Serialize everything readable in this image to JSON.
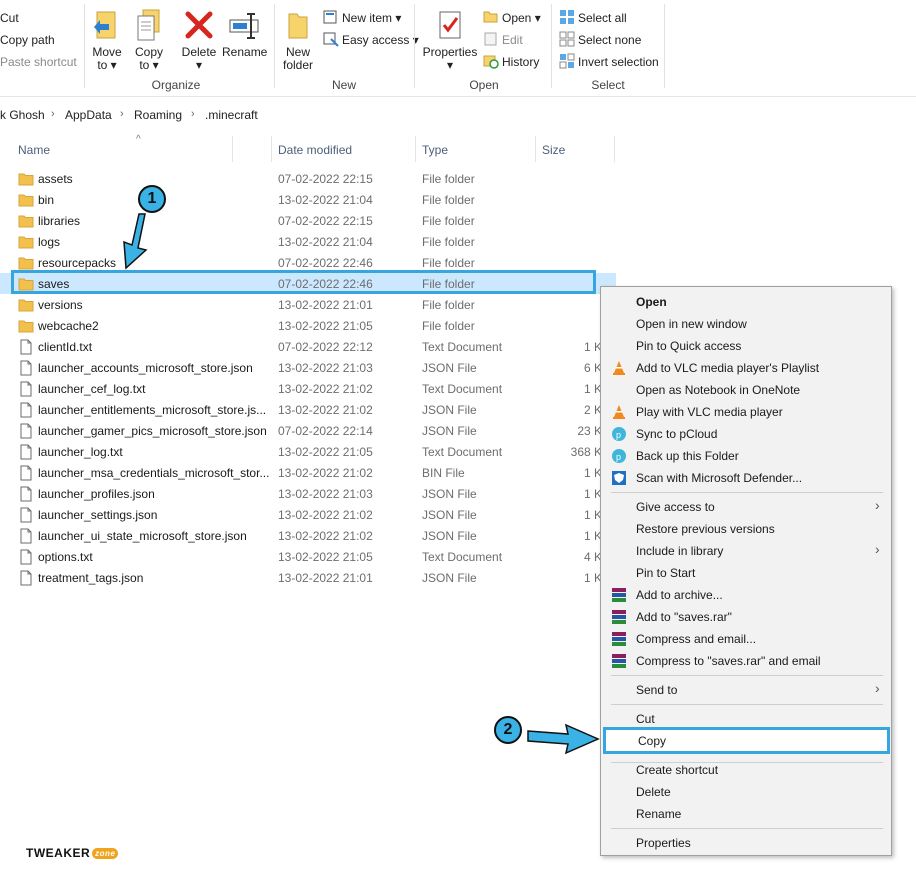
{
  "ribbon": {
    "clipboard": {
      "cut": "Cut",
      "copy_path": "Copy path",
      "paste_shortcut": "Paste shortcut"
    },
    "organize": {
      "move_to": "Move",
      "move_to2": "to ▾",
      "copy_to": "Copy",
      "copy_to2": "to ▾",
      "delete": "Delete",
      "delete2": "▾",
      "rename": "Rename",
      "label": "Organize"
    },
    "new": {
      "new_folder": "New",
      "new_folder2": "folder",
      "new_item": "New item ▾",
      "easy_access": "Easy access ▾",
      "label": "New"
    },
    "open": {
      "properties": "Properties",
      "properties2": "▾",
      "open": "Open ▾",
      "edit": "Edit",
      "history": "History",
      "label": "Open"
    },
    "select": {
      "select_all": "Select all",
      "select_none": "Select none",
      "invert": "Invert selection",
      "label": "Select"
    }
  },
  "breadcrumb": [
    "k Ghosh",
    "AppData",
    "Roaming",
    ".minecraft"
  ],
  "columns": {
    "name": "Name",
    "date": "Date modified",
    "type": "Type",
    "size": "Size"
  },
  "files": [
    {
      "name": "assets",
      "date": "07-02-2022 22:15",
      "type": "File folder",
      "size": "",
      "kind": "folder"
    },
    {
      "name": "bin",
      "date": "13-02-2022 21:04",
      "type": "File folder",
      "size": "",
      "kind": "folder"
    },
    {
      "name": "libraries",
      "date": "07-02-2022 22:15",
      "type": "File folder",
      "size": "",
      "kind": "folder"
    },
    {
      "name": "logs",
      "date": "13-02-2022 21:04",
      "type": "File folder",
      "size": "",
      "kind": "folder"
    },
    {
      "name": "resourcepacks",
      "date": "07-02-2022 22:46",
      "type": "File folder",
      "size": "",
      "kind": "folder"
    },
    {
      "name": "saves",
      "date": "07-02-2022 22:46",
      "type": "File folder",
      "size": "",
      "kind": "folder",
      "selected": true
    },
    {
      "name": "versions",
      "date": "13-02-2022 21:01",
      "type": "File folder",
      "size": "",
      "kind": "folder"
    },
    {
      "name": "webcache2",
      "date": "13-02-2022 21:05",
      "type": "File folder",
      "size": "",
      "kind": "folder"
    },
    {
      "name": "clientId.txt",
      "date": "07-02-2022 22:12",
      "type": "Text Document",
      "size": "1 K",
      "kind": "file"
    },
    {
      "name": "launcher_accounts_microsoft_store.json",
      "date": "13-02-2022 21:03",
      "type": "JSON File",
      "size": "6 K",
      "kind": "file"
    },
    {
      "name": "launcher_cef_log.txt",
      "date": "13-02-2022 21:02",
      "type": "Text Document",
      "size": "1 K",
      "kind": "file"
    },
    {
      "name": "launcher_entitlements_microsoft_store.js...",
      "date": "13-02-2022 21:02",
      "type": "JSON File",
      "size": "2 K",
      "kind": "file"
    },
    {
      "name": "launcher_gamer_pics_microsoft_store.json",
      "date": "07-02-2022 22:14",
      "type": "JSON File",
      "size": "23 K",
      "kind": "file"
    },
    {
      "name": "launcher_log.txt",
      "date": "13-02-2022 21:05",
      "type": "Text Document",
      "size": "368 K",
      "kind": "file"
    },
    {
      "name": "launcher_msa_credentials_microsoft_stor...",
      "date": "13-02-2022 21:02",
      "type": "BIN File",
      "size": "1 K",
      "kind": "file"
    },
    {
      "name": "launcher_profiles.json",
      "date": "13-02-2022 21:03",
      "type": "JSON File",
      "size": "1 K",
      "kind": "file"
    },
    {
      "name": "launcher_settings.json",
      "date": "13-02-2022 21:02",
      "type": "JSON File",
      "size": "1 K",
      "kind": "file"
    },
    {
      "name": "launcher_ui_state_microsoft_store.json",
      "date": "13-02-2022 21:02",
      "type": "JSON File",
      "size": "1 K",
      "kind": "file"
    },
    {
      "name": "options.txt",
      "date": "13-02-2022 21:05",
      "type": "Text Document",
      "size": "4 K",
      "kind": "file"
    },
    {
      "name": "treatment_tags.json",
      "date": "13-02-2022 21:01",
      "type": "JSON File",
      "size": "1 K",
      "kind": "file"
    }
  ],
  "context_menu": {
    "open": "Open",
    "open_new_window": "Open in new window",
    "pin_quick": "Pin to Quick access",
    "vlc_playlist": "Add to VLC media player's Playlist",
    "onenote": "Open as Notebook in OneNote",
    "vlc_play": "Play with VLC media player",
    "pcloud": "Sync to pCloud",
    "backup": "Back up this Folder",
    "defender": "Scan with Microsoft Defender...",
    "give_access": "Give access to",
    "restore": "Restore previous versions",
    "include_library": "Include in library",
    "pin_start": "Pin to Start",
    "add_archive": "Add to archive...",
    "add_rar": "Add to \"saves.rar\"",
    "compress_email": "Compress and email...",
    "compress_rar_email": "Compress to \"saves.rar\" and email",
    "send_to": "Send to",
    "cut": "Cut",
    "copy": "Copy",
    "create_shortcut": "Create shortcut",
    "delete": "Delete",
    "rename": "Rename",
    "properties": "Properties"
  },
  "annotations": {
    "step1": "1",
    "step2": "2"
  },
  "logo": {
    "text": "TWEAKER",
    "badge": "zone"
  },
  "colors": {
    "accent": "#37a6de",
    "selection": "#cce8ff",
    "folder": "#f2c04d"
  }
}
